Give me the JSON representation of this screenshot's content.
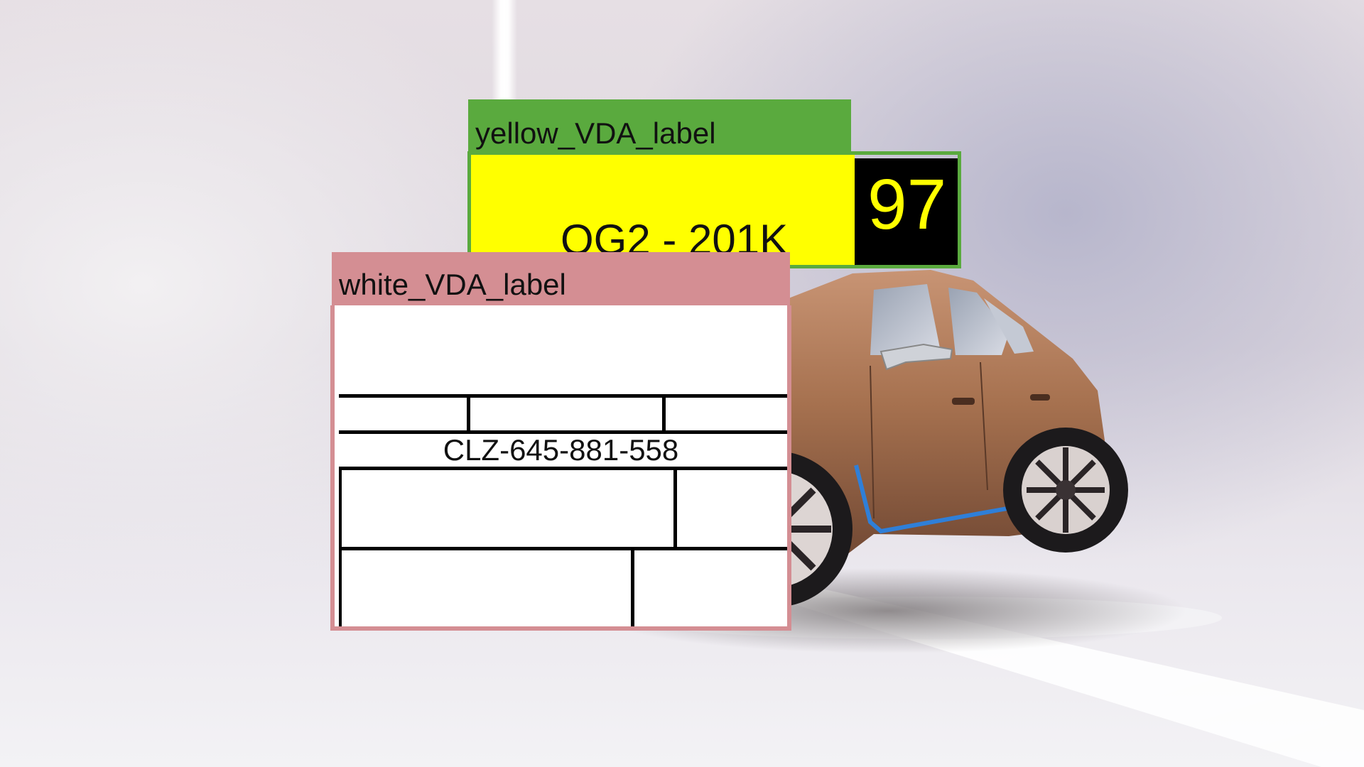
{
  "scene": {
    "subject": "electric-sedan",
    "colors": {
      "background": "#e3dde3",
      "car_body": "#a6714f",
      "accent_trim": "#2f7fd8",
      "yellow_label_header": "#5aaa3e",
      "yellow_label_body": "#ffff00",
      "white_label_header": "#d48e93"
    }
  },
  "yellow_label": {
    "title": "yellow_VDA_label",
    "code": "QG2 - 201K",
    "number": "97"
  },
  "white_label": {
    "title": "white_VDA_label",
    "code": "CLZ-645-881-558"
  }
}
